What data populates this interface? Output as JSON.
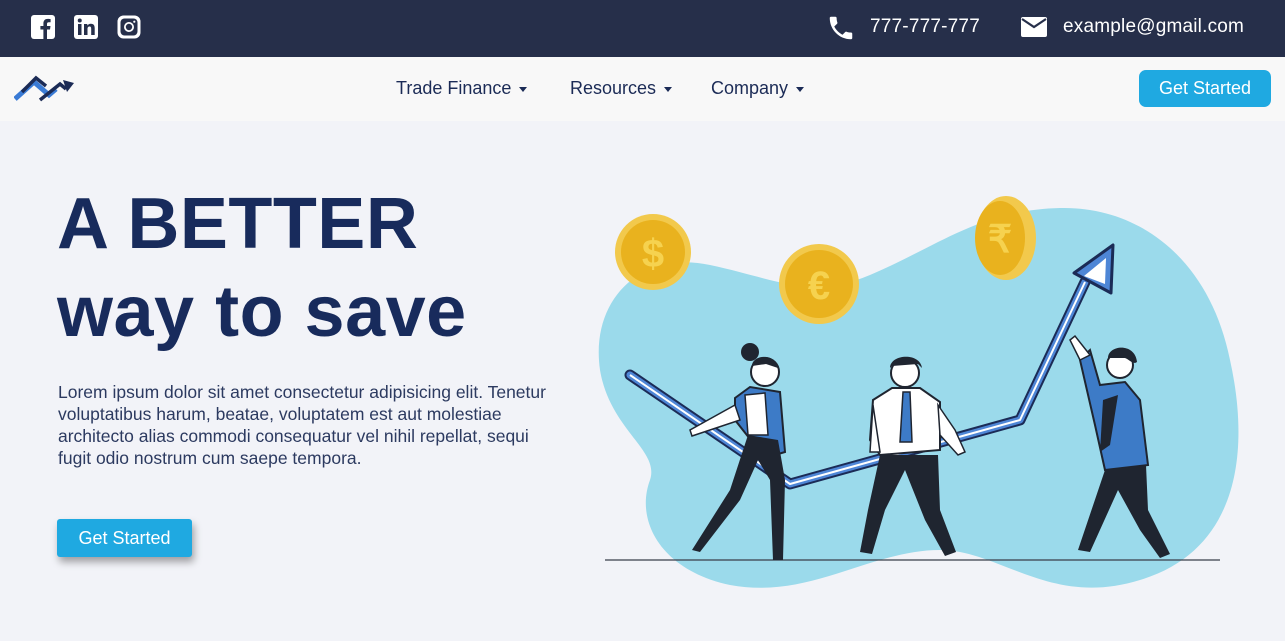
{
  "topbar": {
    "social_icons": [
      "facebook-icon",
      "linkedin-icon",
      "instagram-icon"
    ],
    "phone": "777-777-777",
    "email": "example@gmail.com"
  },
  "nav": {
    "items": [
      {
        "label": "Trade Finance"
      },
      {
        "label": "Resources"
      },
      {
        "label": "Company"
      }
    ],
    "cta": "Get Started"
  },
  "hero": {
    "title_line1": "A BETTER",
    "title_line2": "way to save",
    "description": "Lorem ipsum dolor sit amet consectetur adipisicing elit. Tenetur voluptatibus harum, beatae, voluptatem est aut molestiae architecto alias commodi consequatur vel nihil repellat, sequi fugit odio nostrum cum saepe tempora.",
    "cta": "Get Started"
  },
  "illustration": {
    "coin_symbols": [
      "$",
      "€",
      "₹"
    ]
  },
  "colors": {
    "topbar_bg": "#262f4a",
    "accent": "#1fa9e1",
    "title": "#182b5c",
    "blob": "#9bdaeb",
    "coin": "#e9b21e"
  }
}
